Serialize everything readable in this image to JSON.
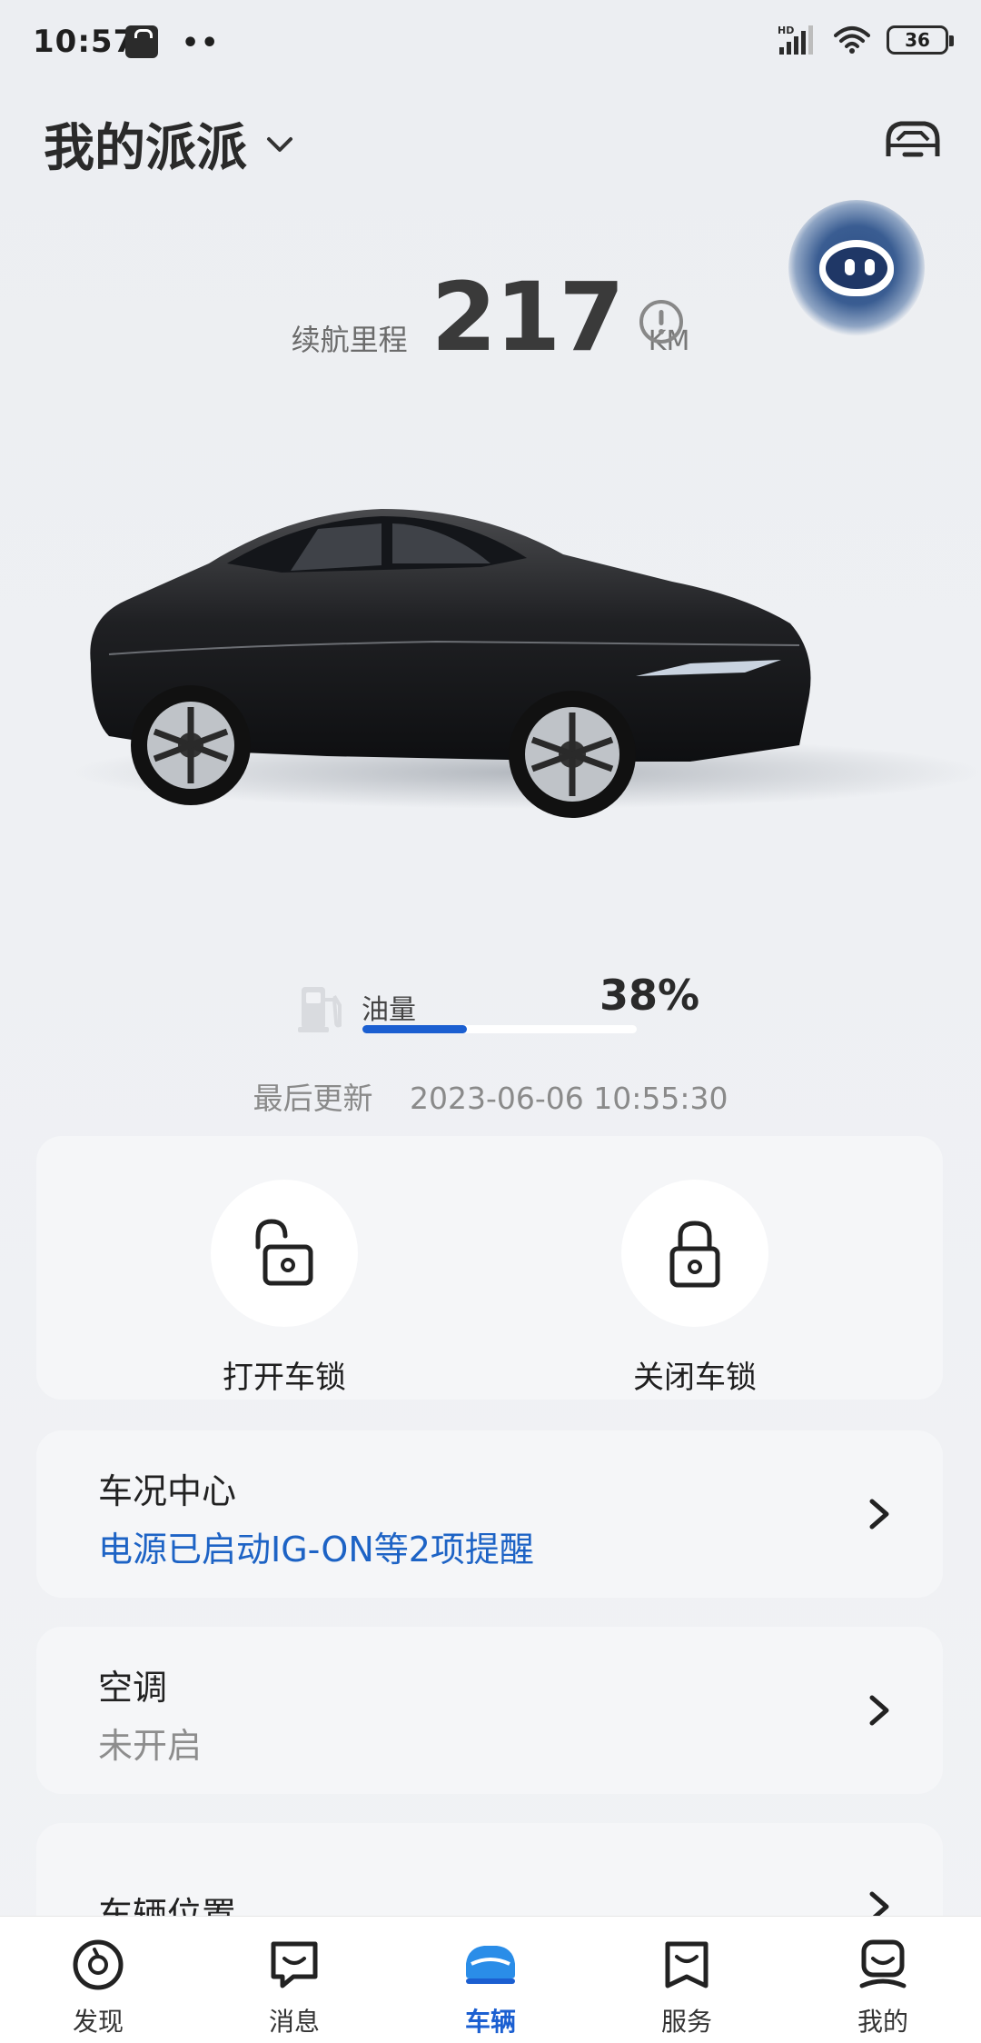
{
  "status_bar": {
    "time": "10:57",
    "dots": "••",
    "network": "HD",
    "battery": "36"
  },
  "header": {
    "title": "我的派派"
  },
  "range": {
    "label": "续航里程",
    "value": "217",
    "unit": "KM"
  },
  "fuel": {
    "label": "油量",
    "percent_text": "38%",
    "level": 0.38,
    "bar_color": "#1b5fd1"
  },
  "last_update": {
    "label": "最后更新",
    "time": "2023-06-06 10:55:30"
  },
  "lock_actions": {
    "unlock_label": "打开车锁",
    "lock_label": "关闭车锁"
  },
  "cards": [
    {
      "title": "车况中心",
      "subtitle": "电源已启动IG-ON等2项提醒",
      "subtitle_color": "#1d63c5"
    },
    {
      "title": "空调",
      "subtitle": "未开启",
      "subtitle_color": "#8d8d8d"
    },
    {
      "title": "车辆位置"
    }
  ],
  "bottom_nav": [
    {
      "label": "发现",
      "icon": "discover-icon"
    },
    {
      "label": "消息",
      "icon": "message-icon"
    },
    {
      "label": "车辆",
      "icon": "car-icon",
      "active": true
    },
    {
      "label": "服务",
      "icon": "service-icon"
    },
    {
      "label": "我的",
      "icon": "profile-icon"
    }
  ],
  "colors": {
    "accent": "#1b5fd1",
    "background": "#eef0f3"
  }
}
